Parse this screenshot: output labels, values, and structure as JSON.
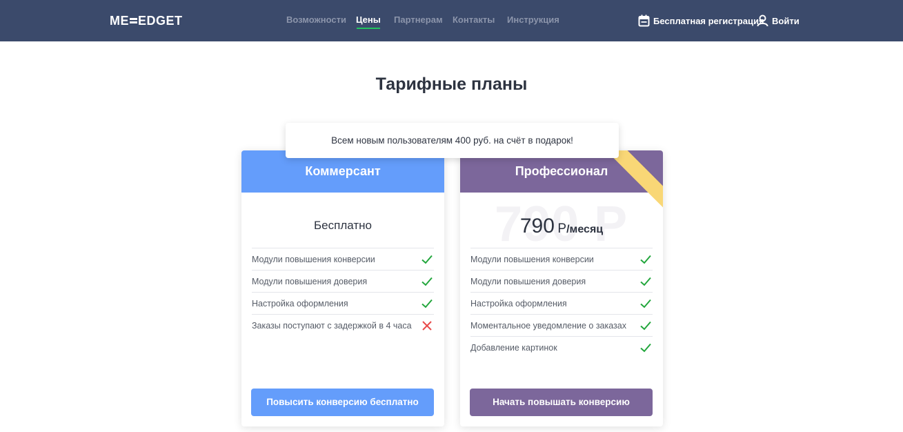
{
  "header": {
    "logo": {
      "left": "ME",
      "right": "EDGET"
    },
    "nav": [
      "Возможности",
      "Цены",
      "Партнерам",
      "Контакты",
      "Инструкция"
    ],
    "active_nav": "Цены",
    "register_label": "Бесплатная регистрация",
    "login_label": "Войти",
    "bg_color": "#3b4a6b",
    "active_underline_color": "#22c55e"
  },
  "page_title": "Тарифные планы",
  "promo": "Всем новым пользователям 400 руб. на счёт в подарок!",
  "plans": [
    {
      "name": "Коммерсант",
      "price_text": "Бесплатно",
      "color": "#649dfb",
      "features": [
        {
          "label": "Модули повышения конверсии",
          "included": true
        },
        {
          "label": "Модули повышения доверия",
          "included": true
        },
        {
          "label": "Настройка оформления",
          "included": true
        },
        {
          "label": "Заказы поступают с задержкой в 4 часа",
          "included": false
        }
      ],
      "button": "Повысить конверсию бесплатно"
    },
    {
      "name": "Профессионал",
      "price_bg": "790 Р",
      "price_amount": "790",
      "price_currency": "Р",
      "price_period": "/месяц",
      "color": "#7c679b",
      "ribbon_color": "#f9d776",
      "features": [
        {
          "label": "Модули повышения конверсии",
          "included": true
        },
        {
          "label": "Модули повышения доверия",
          "included": true
        },
        {
          "label": "Настройка оформления",
          "included": true
        },
        {
          "label": "Моментальное уведомление о заказах",
          "included": true
        },
        {
          "label": "Добавление картинок",
          "included": true
        }
      ],
      "button": "Начать повышать конверсию"
    }
  ],
  "icons": {
    "included": "check-icon",
    "excluded": "cross-icon",
    "register": "calendar-icon",
    "login": "user-icon"
  },
  "colors": {
    "check": "#22a63c",
    "cross": "#e84a4a"
  }
}
